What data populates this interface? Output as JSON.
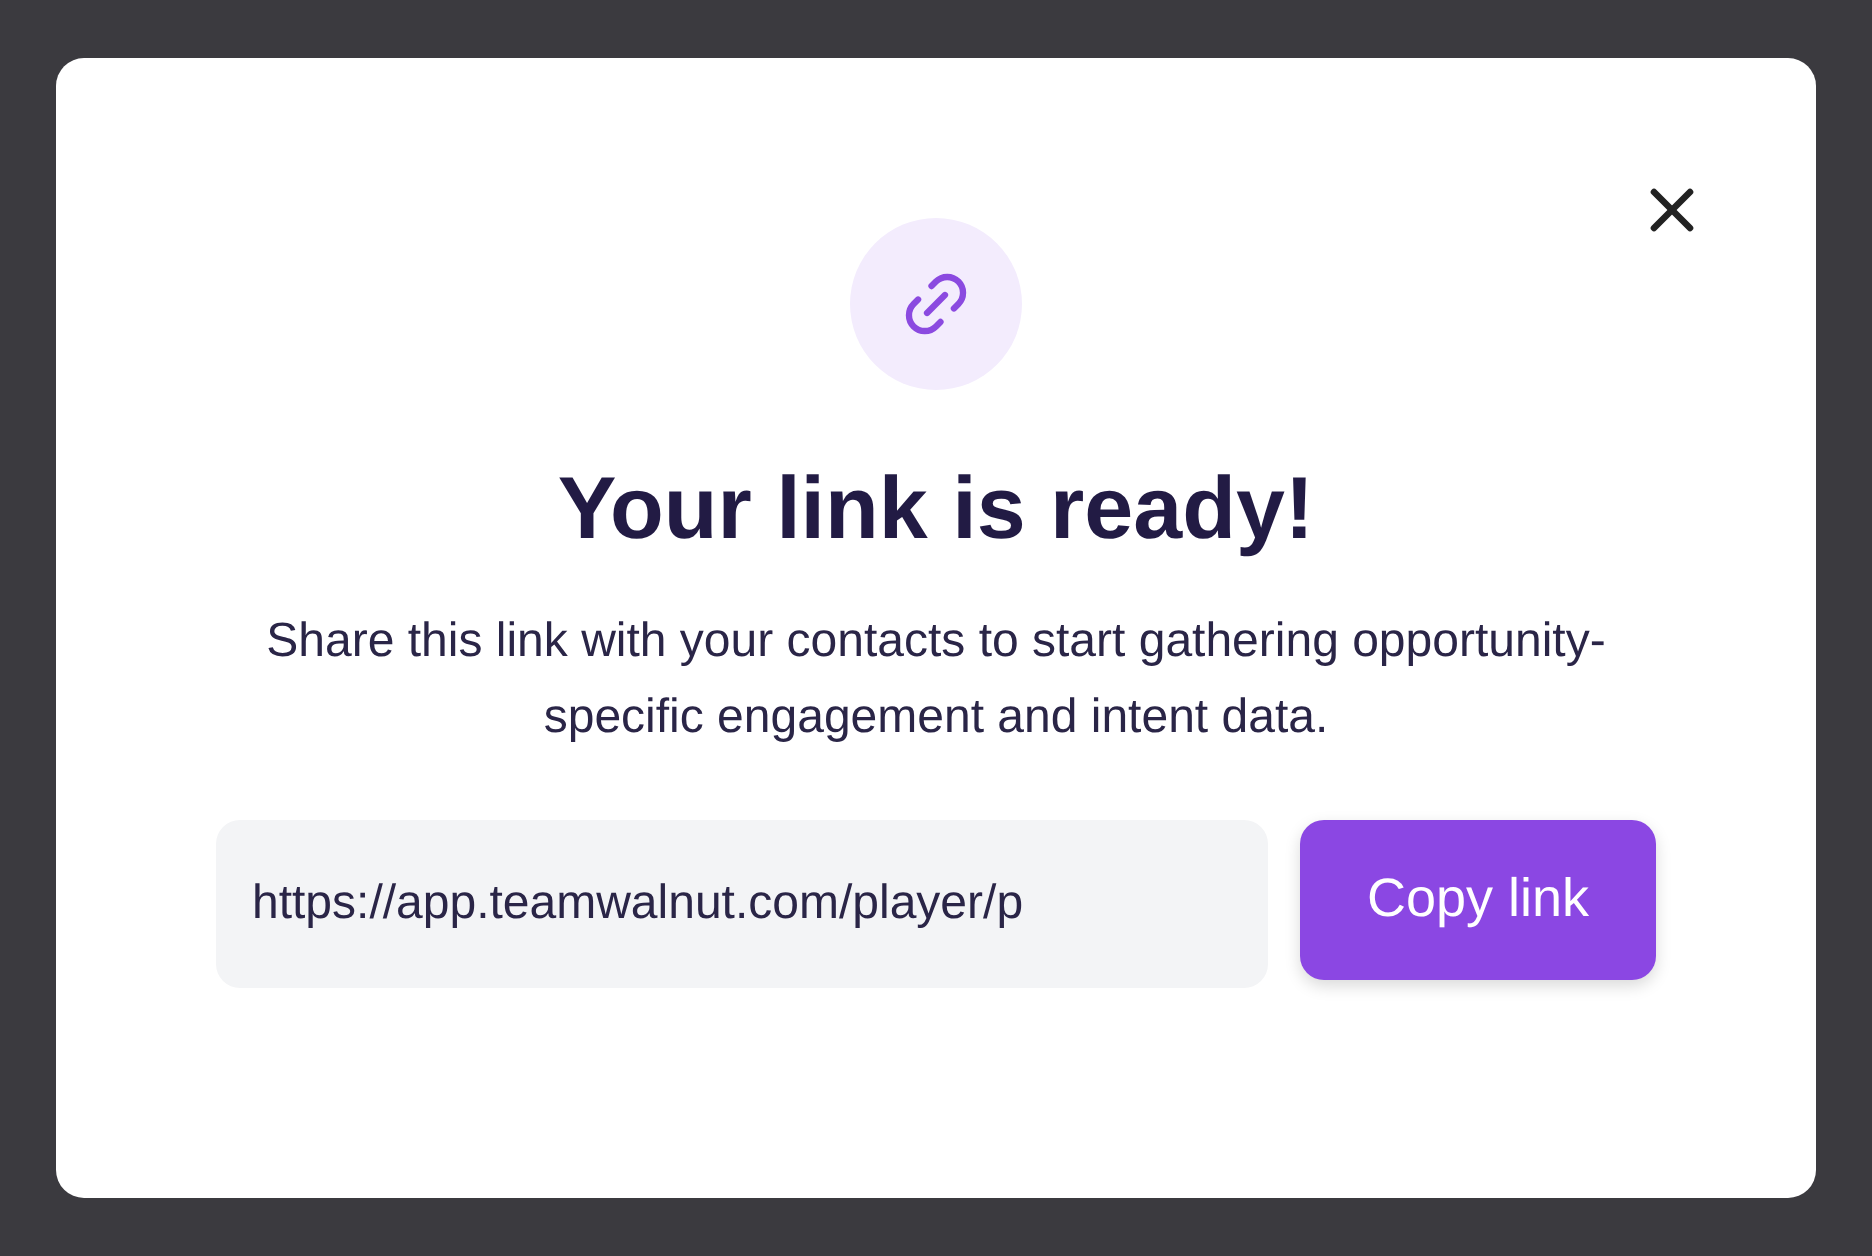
{
  "dialog": {
    "title": "Your link is ready!",
    "description": "Share this link with your contacts to start gathering opportunity-specific engagement and intent data.",
    "link_field": {
      "value": "https://app.teamwalnut.com/player/p"
    },
    "copy_button": {
      "label": "Copy link"
    }
  }
}
